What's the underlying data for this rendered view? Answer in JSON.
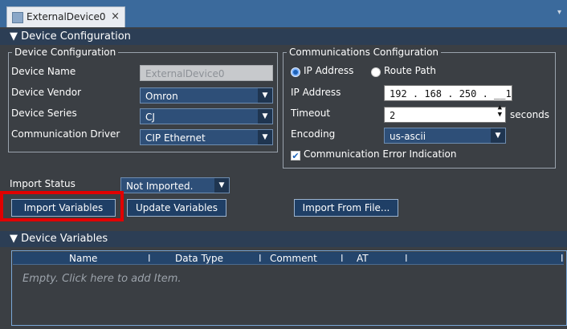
{
  "tab": {
    "title": "ExternalDevice0",
    "close": "×"
  },
  "device_configuration_section": {
    "label": "▼ Device Configuration"
  },
  "device_group": {
    "legend": "Device Configuration",
    "device_name_label": "Device Name",
    "device_name_value": "ExternalDevice0",
    "vendor_label": "Device Vendor",
    "vendor_value": "Omron",
    "series_label": "Device Series",
    "series_value": "CJ",
    "driver_label": "Communication Driver",
    "driver_value": "CIP Ethernet"
  },
  "comm_group": {
    "legend": "Communications Configuration",
    "radio_ip_label": "IP Address",
    "radio_route_label": "Route Path",
    "selected_mode": "IP Address",
    "ip_label": "IP Address",
    "ip_value": "192 . 168 . 250 . __1",
    "timeout_label": "Timeout",
    "timeout_value": "2",
    "timeout_unit": "seconds",
    "encoding_label": "Encoding",
    "encoding_value": "us-ascii",
    "error_indication_label": "Communication Error Indication",
    "error_indication_checked": true
  },
  "import_status": {
    "label": "Import Status",
    "value": "Not Imported."
  },
  "buttons": {
    "import_variables": "Import Variables",
    "update_variables": "Update Variables",
    "import_from_file": "Import From File..."
  },
  "device_variables_section": {
    "label": "▼ Device Variables"
  },
  "variables_table": {
    "columns": [
      "Name",
      "Data Type",
      "Comment",
      "AT"
    ],
    "separator": "I",
    "empty_text": "Empty. Click here to add Item."
  },
  "colors": {
    "highlight": "#e10000",
    "header": "#2c3e55",
    "background": "#3b3f44"
  }
}
